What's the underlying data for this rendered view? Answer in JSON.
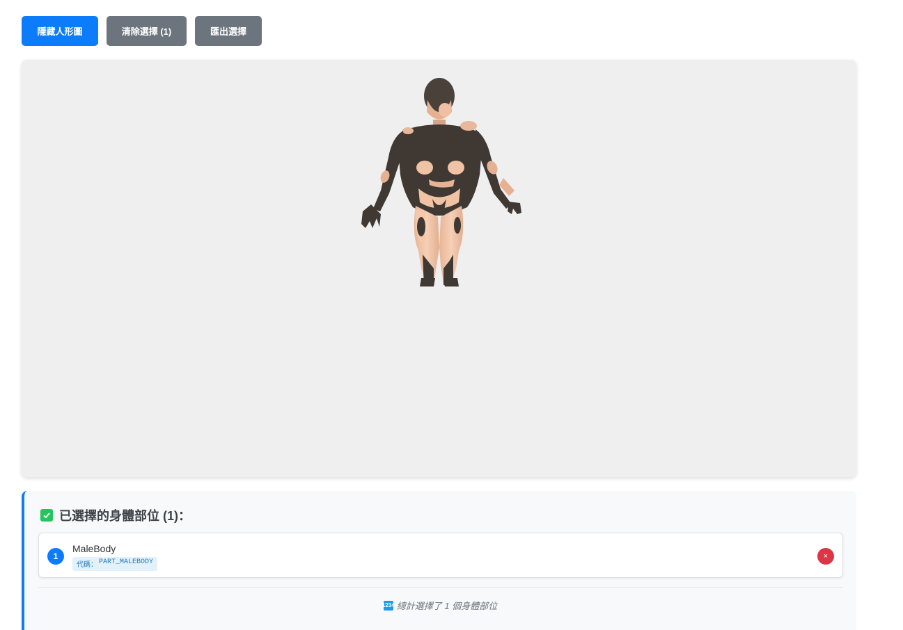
{
  "toolbar": {
    "hide_label": "隱藏人形圖",
    "clear_label": "清除選擇 (1)",
    "export_label": "匯出選擇"
  },
  "viewer": {
    "model_name": "human-body-3d-model"
  },
  "selection": {
    "title": "已選擇的身體部位 (1)：",
    "items": [
      {
        "index": "1",
        "name": "MaleBody",
        "code_label": "代碼：",
        "code": "PART_MALEBODY",
        "remove_symbol": "×"
      }
    ],
    "total_text": "總計選擇了 1 個身體部位",
    "total_icon_text": "1234"
  },
  "colors": {
    "primary": "#0d7cfb",
    "secondary": "#6c757d",
    "danger": "#dc3545",
    "success": "#22c55e",
    "skin": "#f1c4a6",
    "selected_part": "#403832",
    "viewer_bg": "#efefef"
  }
}
